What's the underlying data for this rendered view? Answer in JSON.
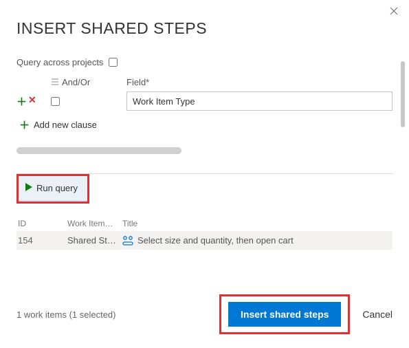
{
  "dialog": {
    "title": "INSERT SHARED STEPS"
  },
  "query": {
    "across_label": "Query across projects",
    "across_checked": false,
    "header": {
      "andor": "And/Or",
      "field": "Field*"
    },
    "clause": {
      "field_value": "Work Item Type"
    },
    "add_clause": "Add new clause",
    "run_query": "Run query"
  },
  "table": {
    "headers": {
      "id": "ID",
      "workitem": "Work Item…",
      "title": "Title"
    },
    "rows": [
      {
        "id": "154",
        "workitem": "Shared St…",
        "title": "Select size and quantity, then open cart"
      }
    ]
  },
  "footer": {
    "status": "1 work items (1 selected)",
    "insert": "Insert shared steps",
    "cancel": "Cancel"
  }
}
